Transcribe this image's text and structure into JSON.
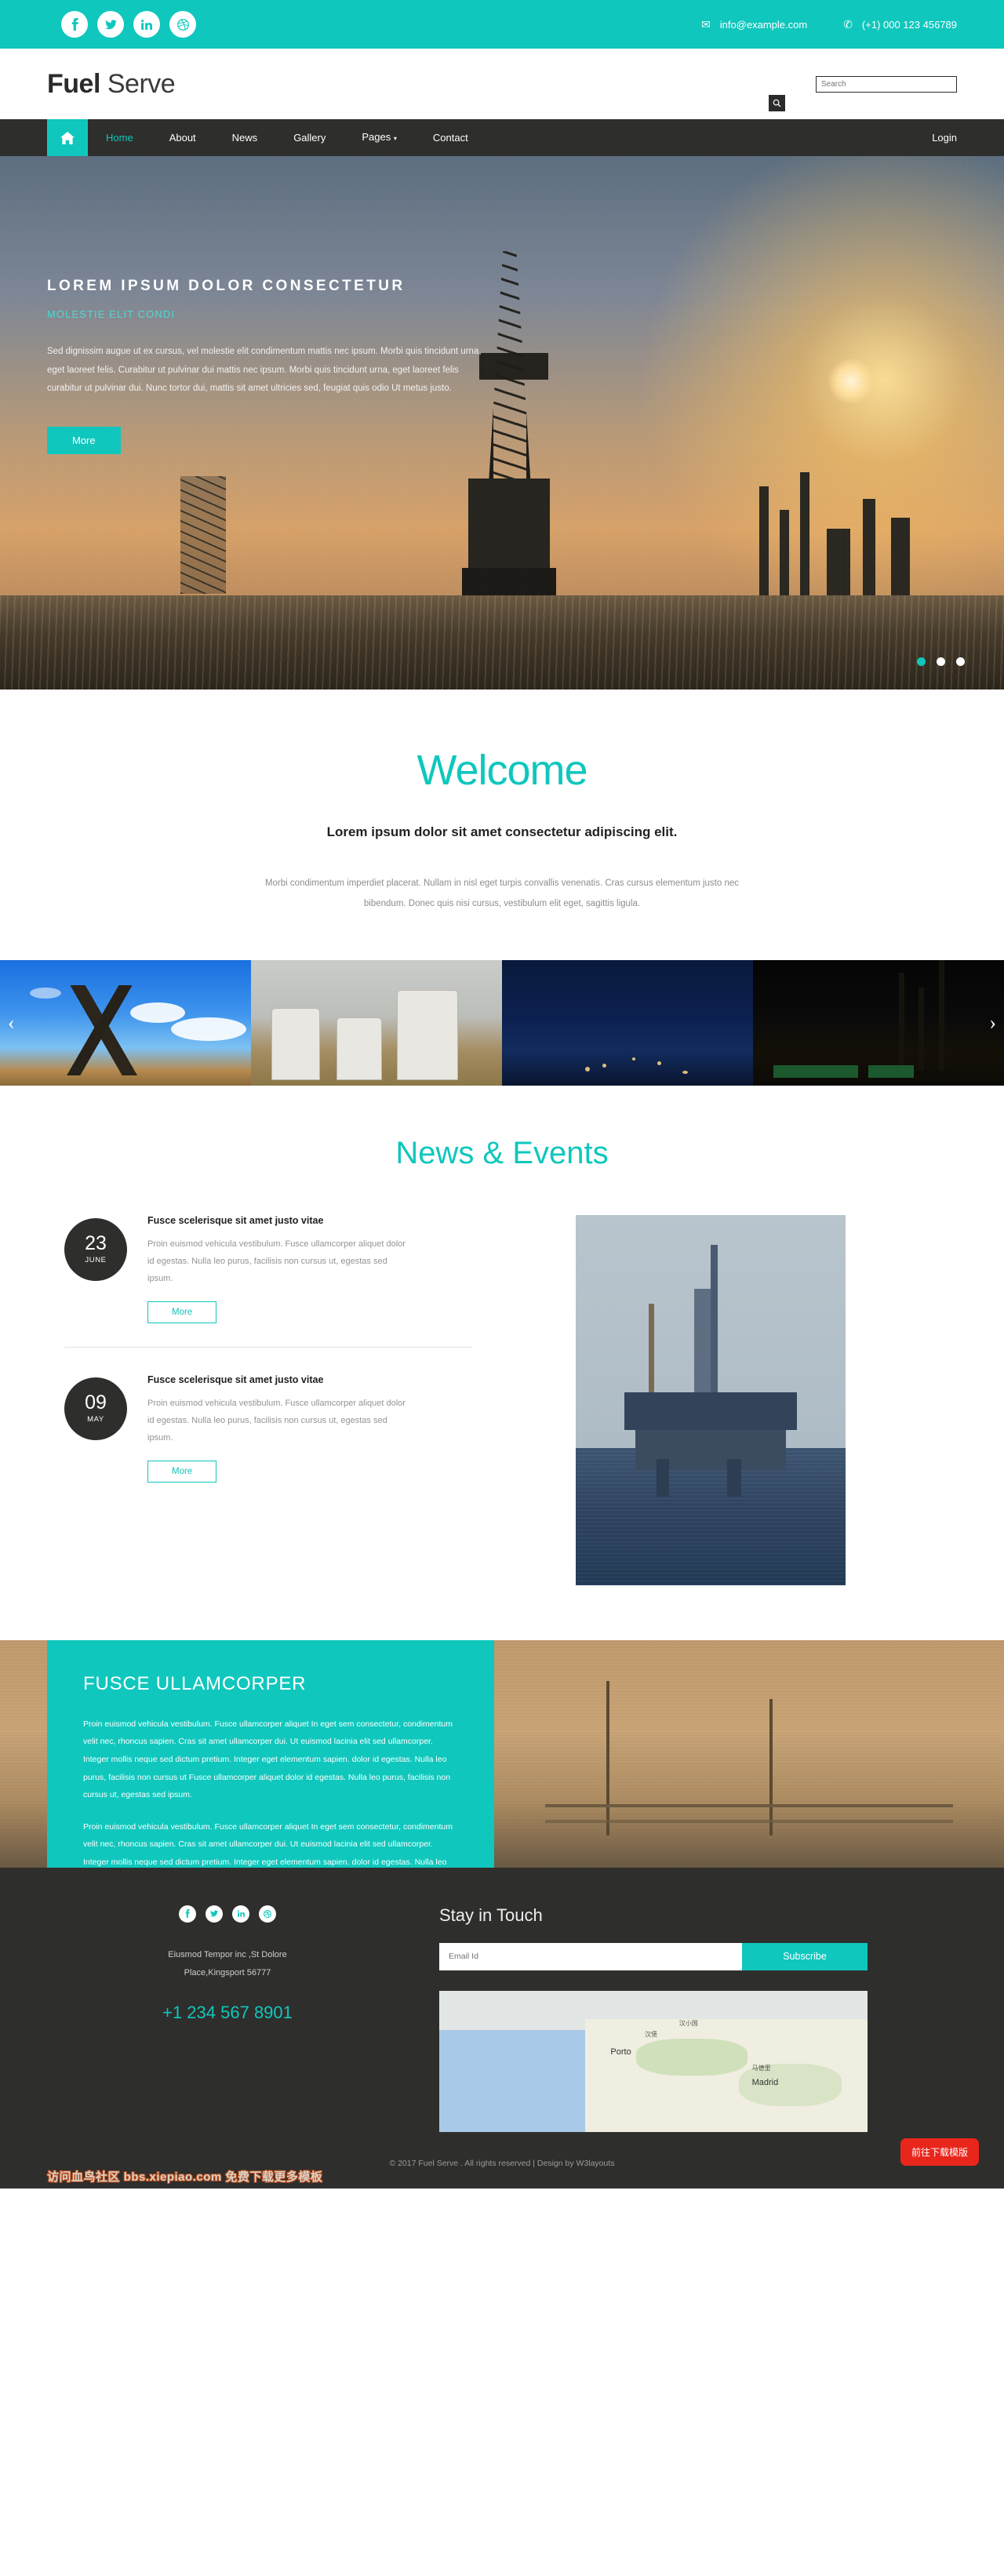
{
  "topbar": {
    "social": [
      {
        "name": "facebook-icon",
        "glyph": "f"
      },
      {
        "name": "twitter-icon",
        "glyph": "t"
      },
      {
        "name": "linkedin-icon",
        "glyph": "in"
      },
      {
        "name": "dribbble-icon",
        "glyph": "d"
      }
    ],
    "email": "info@example.com",
    "phone": "(+1) 000 123 456789",
    "accent": "#0fc7bd"
  },
  "header": {
    "logo_bold": "Fuel",
    "logo_light": " Serve",
    "search_placeholder": "Search",
    "search_value": ""
  },
  "nav": {
    "home_icon": "home-icon",
    "items": [
      {
        "label": "Home",
        "active": true
      },
      {
        "label": "About",
        "active": false
      },
      {
        "label": "News",
        "active": false
      },
      {
        "label": "Gallery",
        "active": false
      },
      {
        "label": "Pages",
        "active": false,
        "caret": true
      },
      {
        "label": "Contact",
        "active": false
      }
    ],
    "login": "Login"
  },
  "hero": {
    "title": "Lorem ipsum dolor consectetur",
    "subtitle": "Molestie elit condi",
    "paragraph": "Sed dignissim augue ut ex cursus, vel molestie elit condimentum mattis nec ipsum. Morbi quis tincidunt urna, eget laoreet felis. Curabitur ut pulvinar dui mattis nec ipsum. Morbi quis tincidunt urna, eget laoreet felis curabitur ut pulvinar dui. Nunc tortor dui, mattis sit amet ultricies sed, feugiat quis odio Ut metus justo.",
    "button": "More",
    "dots": 3,
    "active_dot": 0
  },
  "welcome": {
    "heading": "Welcome",
    "subheading": "Lorem ipsum dolor sit amet consectetur adipiscing elit.",
    "paragraph": "Morbi condimentum imperdiet placerat. Nullam in nisl eget turpis convallis venenatis. Cras cursus elementum justo nec bibendum. Donec quis nisi cursus, vestibulum elit eget, sagittis ligula."
  },
  "gallery": {
    "prev": "‹",
    "next": "›",
    "items": [
      {
        "name": "pumpjack-photo"
      },
      {
        "name": "oil-tanks-photo"
      },
      {
        "name": "refinery-night-photo"
      },
      {
        "name": "power-plant-night-photo"
      }
    ]
  },
  "news": {
    "heading": "News & Events",
    "items": [
      {
        "day": "23",
        "month": "JUNE",
        "title": "Fusce scelerisque sit amet justo vitae",
        "text": "Proin euismod vehicula vestibulum. Fusce ullamcorper aliquet dolor id egestas. Nulla leo purus, facilisis non cursus ut, egestas sed ipsum.",
        "button": "More"
      },
      {
        "day": "09",
        "month": "MAY",
        "title": "Fusce scelerisque sit amet justo vitae",
        "text": "Proin euismod vehicula vestibulum. Fusce ullamcorper aliquet dolor id egestas. Nulla leo purus, facilisis non cursus ut, egestas sed ipsum.",
        "button": "More"
      }
    ],
    "photo_name": "offshore-rig-photo"
  },
  "feature": {
    "title": "FUSCE ULLAMCORPER",
    "paragraph1": "Proin euismod vehicula vestibulum. Fusce ullamcorper aliquet In eget sem consectetur, condimentum velit nec, rhoncus sapien. Cras sit amet ullamcorper dui. Ut euismod lacinia elit sed ullamcorper. Integer mollis neque sed dictum pretium. Integer eget elementum sapien. dolor id egestas. Nulla leo purus, facilisis non cursus ut Fusce ullamcorper aliquet dolor id egestas. Nulla leo purus, facilisis non cursus ut, egestas sed ipsum.",
    "paragraph2": "Proin euismod vehicula vestibulum. Fusce ullamcorper aliquet In eget sem consectetur, condimentum velit nec, rhoncus sapien. Cras sit amet ullamcorper dui. Ut euismod lacinia elit sed ullamcorper. Integer mollis neque sed dictum pretium. Integer eget elementum sapien. dolor id egestas. Nulla leo purus."
  },
  "footer": {
    "social": [
      {
        "name": "facebook-icon",
        "glyph": "f"
      },
      {
        "name": "twitter-icon",
        "glyph": "t"
      },
      {
        "name": "linkedin-icon",
        "glyph": "in"
      },
      {
        "name": "dribbble-icon",
        "glyph": "d"
      }
    ],
    "address_line1": "Eiusmod Tempor inc ,St Dolore",
    "address_line2": "Place,Kingsport 56777",
    "phone": "+1 234 567 8901",
    "stay_heading": "Stay in Touch",
    "email_placeholder": "Email Id",
    "email_value": "",
    "subscribe_label": "Subscribe",
    "map_labels": [
      "Porto",
      "Madrid",
      "马德里",
      "汉堡",
      "汉小国"
    ]
  },
  "copyright": {
    "text": "© 2017 Fuel Serve . All rights reserved | Design by W3layouts",
    "watermark": "访问血鸟社区 bbs.xiepiao.com 免费下载更多模板",
    "download_badge": "前往下载模版"
  }
}
